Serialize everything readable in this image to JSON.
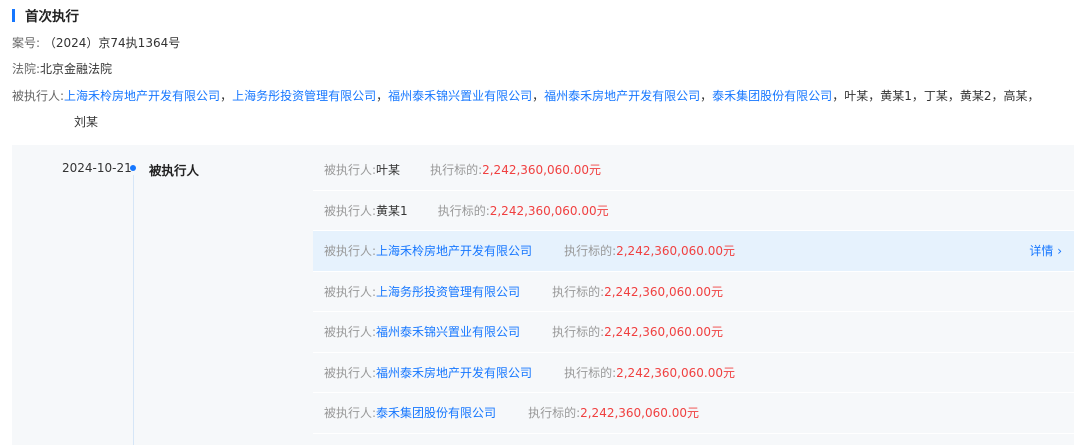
{
  "section": {
    "title": "首次执行"
  },
  "case_no": {
    "label": "案号:",
    "value": "（2024）京74执1364号"
  },
  "court": {
    "label": "法院:",
    "value": "北京金融法院"
  },
  "executed": {
    "label": "被执行人:",
    "links": [
      "上海禾柃房地产开发有限公司",
      "上海务彤投资管理有限公司",
      "福州泰禾锦兴置业有限公司",
      "福州泰禾房地产开发有限公司",
      "泰禾集团股份有限公司"
    ],
    "plain": "叶某，黄某1，丁某，黄某2，高某，",
    "plain2": "刘某"
  },
  "timeline": {
    "date": "2024-10-21",
    "kind": "被执行人",
    "rows": [
      {
        "label": "被执行人:",
        "name": "叶某",
        "link": false,
        "amount_label": "执行标的:",
        "amount": "2,242,360,060.00元"
      },
      {
        "label": "被执行人:",
        "name": "黄某1",
        "link": false,
        "amount_label": "执行标的:",
        "amount": "2,242,360,060.00元"
      },
      {
        "label": "被执行人:",
        "name": "上海禾柃房地产开发有限公司",
        "link": true,
        "amount_label": "执行标的:",
        "amount": "2,242,360,060.00元",
        "detail": "详情 ›"
      },
      {
        "label": "被执行人:",
        "name": "上海务彤投资管理有限公司",
        "link": true,
        "amount_label": "执行标的:",
        "amount": "2,242,360,060.00元"
      },
      {
        "label": "被执行人:",
        "name": "福州泰禾锦兴置业有限公司",
        "link": true,
        "amount_label": "执行标的:",
        "amount": "2,242,360,060.00元"
      },
      {
        "label": "被执行人:",
        "name": "福州泰禾房地产开发有限公司",
        "link": true,
        "amount_label": "执行标的:",
        "amount": "2,242,360,060.00元"
      },
      {
        "label": "被执行人:",
        "name": "泰禾集团股份有限公司",
        "link": true,
        "amount_label": "执行标的:",
        "amount": "2,242,360,060.00元"
      }
    ]
  }
}
